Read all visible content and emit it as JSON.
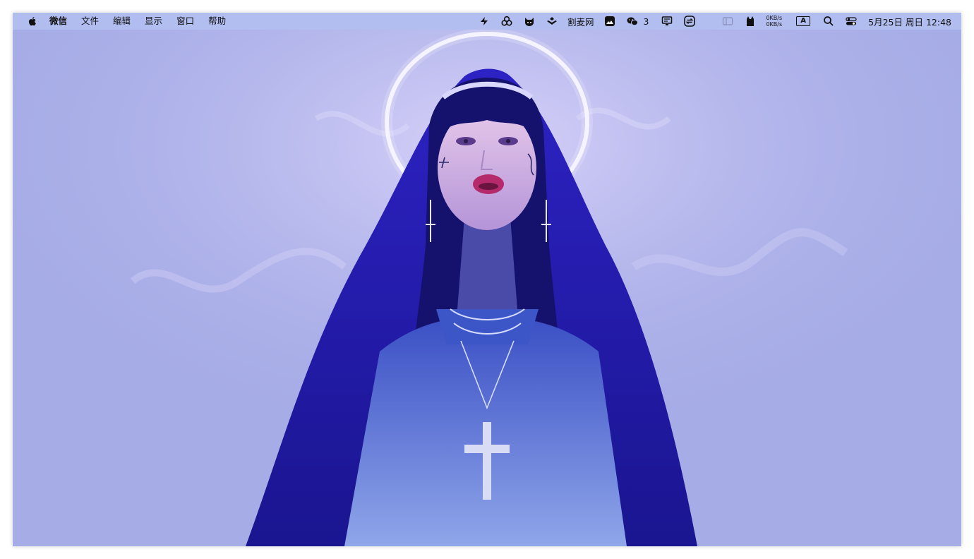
{
  "menubar": {
    "app_name": "微信",
    "menus": [
      "文件",
      "编辑",
      "显示",
      "窗口",
      "帮助"
    ],
    "status_text_app": "割麦网",
    "wechat_badge": "3",
    "net_up": "0KB/s",
    "net_down": "0KB/s",
    "input_source": "A",
    "clock": "5月25日 周日  12:48"
  },
  "icons": [
    "apple-icon",
    "spark-icon",
    "rings-icon",
    "cat-face-icon",
    "hands-icon",
    "image-icon",
    "wechat-icon",
    "monitor-icon",
    "sync-icon",
    "sidebar-icon",
    "cat-silhouette-icon",
    "search-icon",
    "control-center-icon"
  ],
  "colors": {
    "menubar_bg": "#b2bef0",
    "sky": "#a7aeea",
    "robe": "#2a1fb0",
    "halo": "#f4f2ff"
  }
}
